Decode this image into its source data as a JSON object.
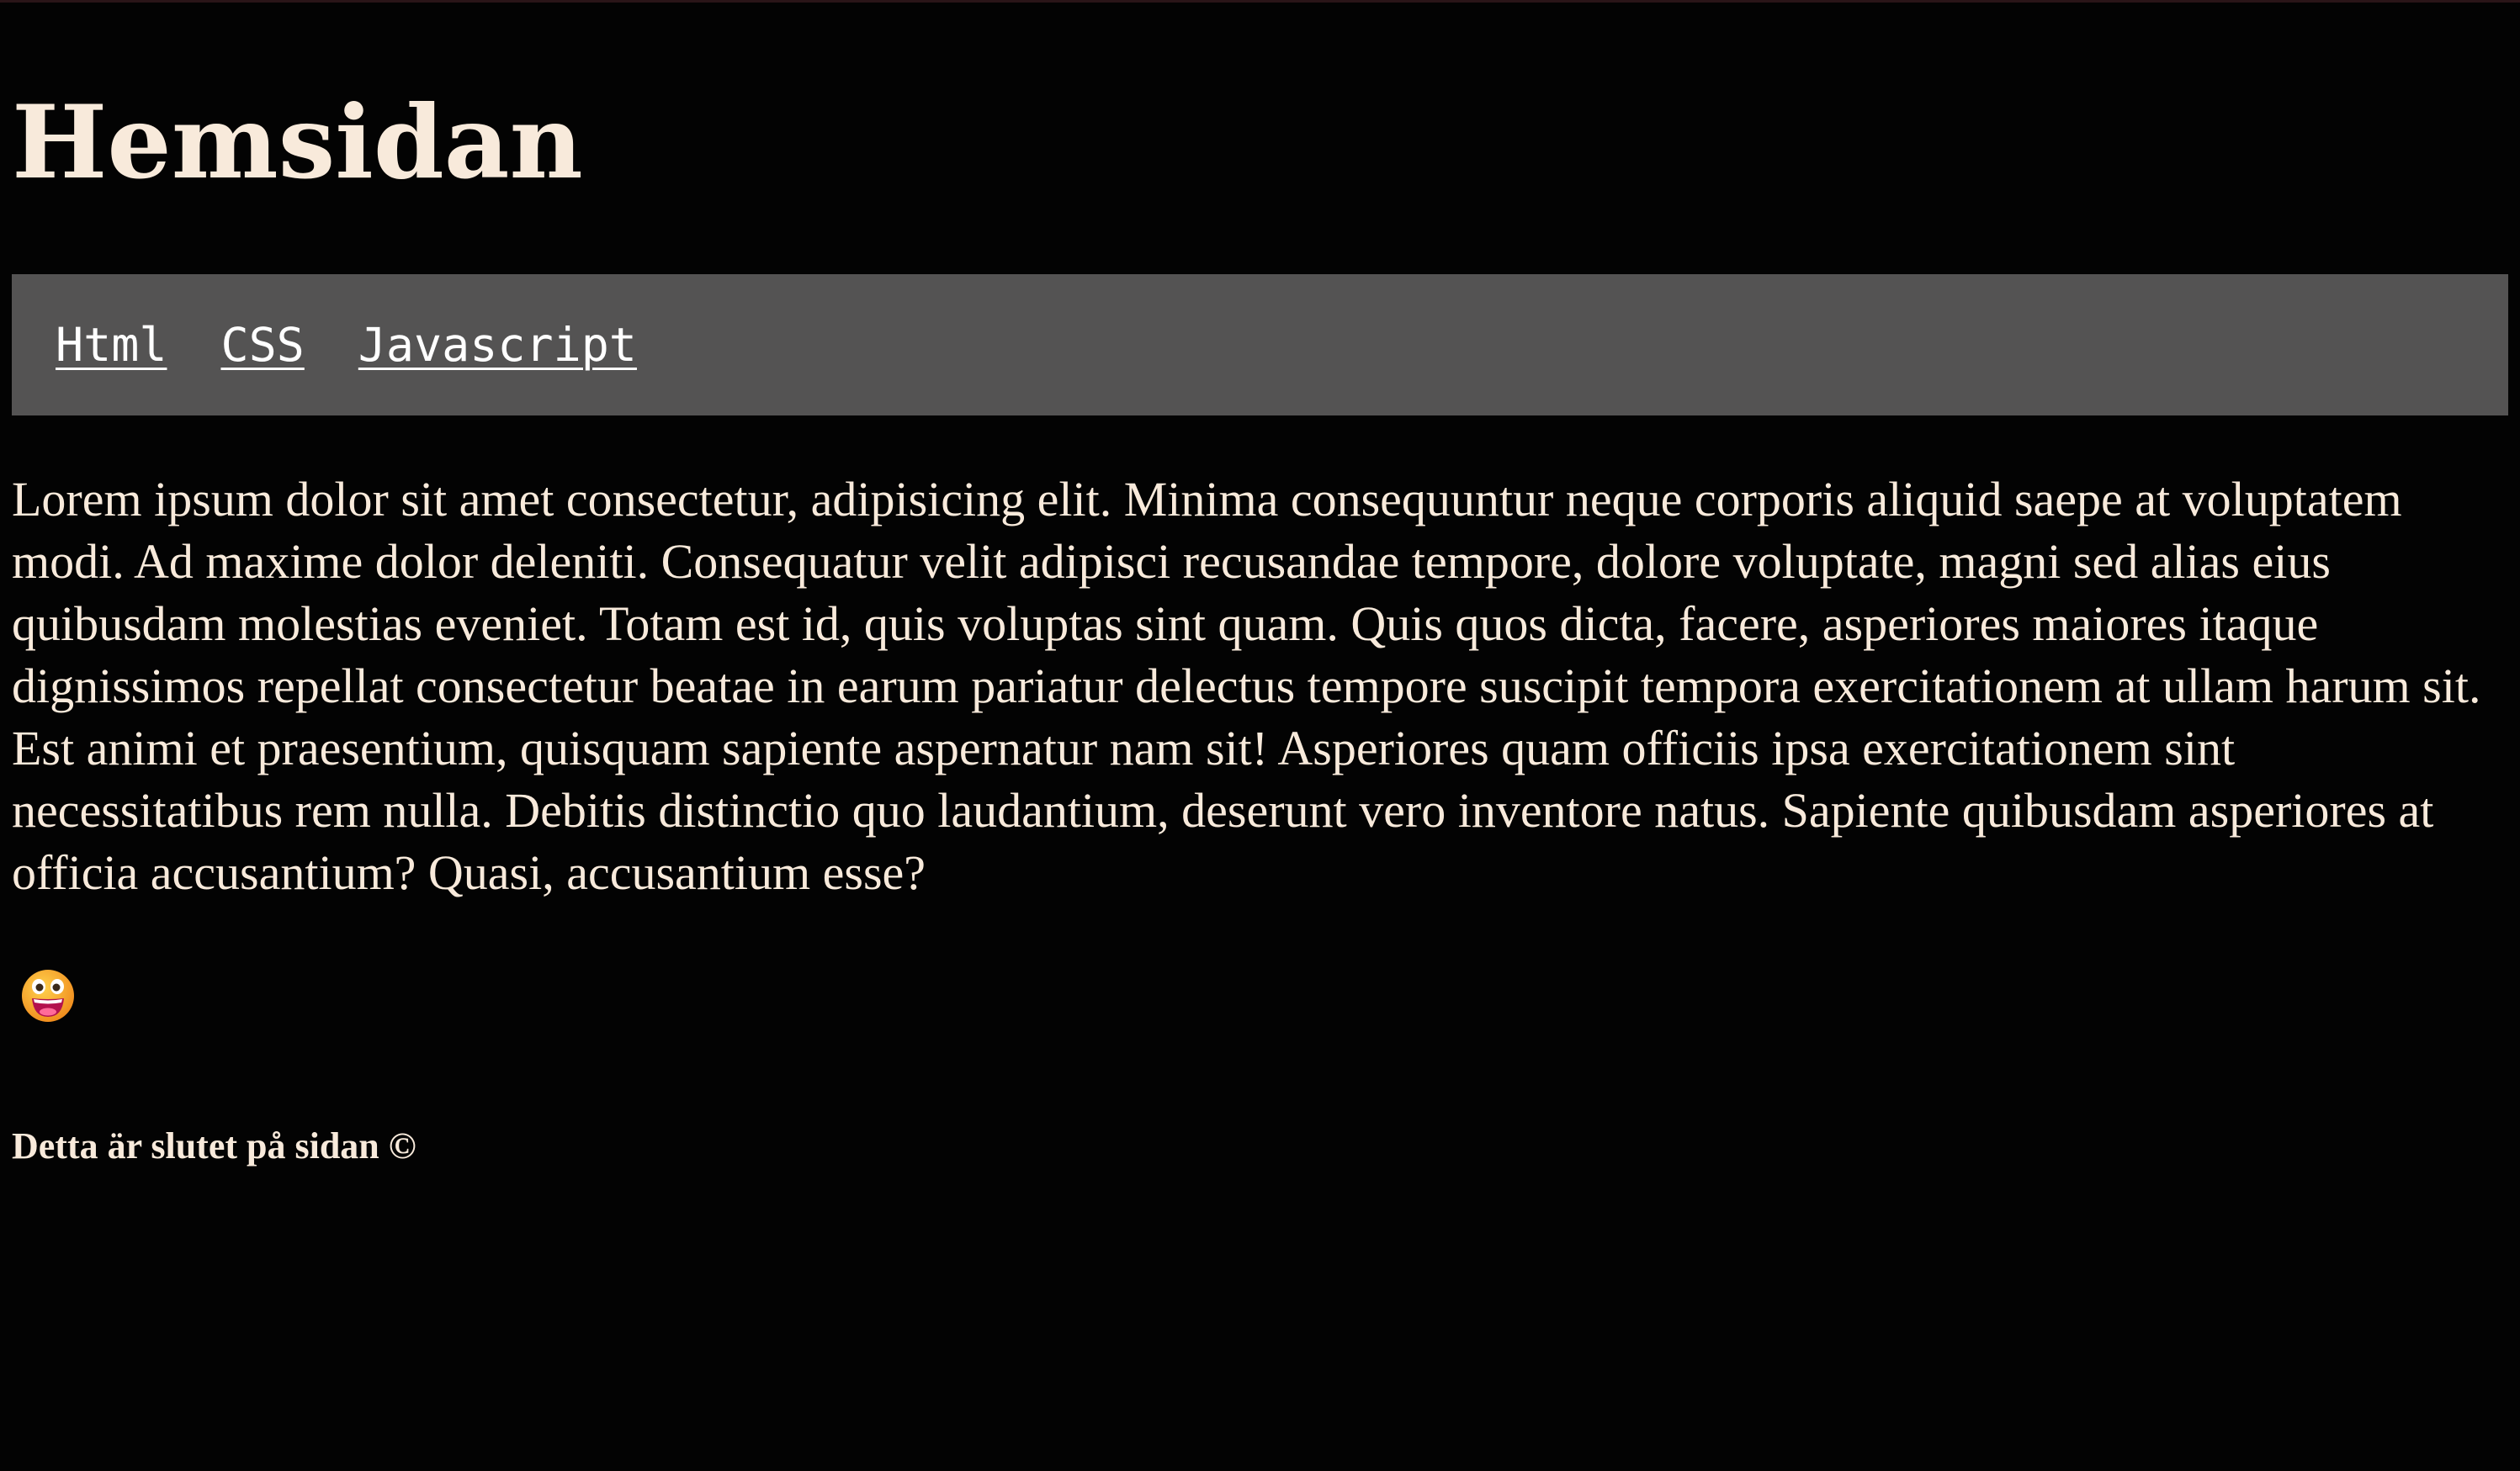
{
  "header": {
    "title": "Hemsidan"
  },
  "nav": {
    "items": [
      {
        "label": "Html"
      },
      {
        "label": "CSS"
      },
      {
        "label": "Javascript"
      }
    ]
  },
  "main": {
    "paragraph": "Lorem ipsum dolor sit amet consectetur, adipisicing elit. Minima consequuntur neque corporis aliquid saepe at voluptatem modi. Ad maxime dolor deleniti. Consequatur velit adipisci recusandae tempore, dolore voluptate, magni sed alias eius quibusdam molestias eveniet. Totam est id, quis voluptas sint quam. Quis quos dicta, facere, asperiores maiores itaque dignissimos repellat consectetur beatae in earum pariatur delectus tempore suscipit tempora exercitationem at ullam harum sit. Est animi et praesentium, quisquam sapiente aspernatur nam sit! Asperiores quam officiis ipsa exercitationem sint necessitatibus rem nulla. Debitis distinctio quo laudantium, deserunt vero inventore natus. Sapiente quibusdam asperiores at officia accusantium? Quasi, accusantium esse?",
    "emoji_icon": "grinning-face-icon"
  },
  "footer": {
    "text": "Detta är slutet på sidan ©"
  },
  "colors": {
    "background": "#030303",
    "text": "#f8eadb",
    "nav_background": "#545353",
    "nav_link": "#ffffff",
    "emoji_face": "#f5a623",
    "emoji_mouth": "#c2185b"
  }
}
